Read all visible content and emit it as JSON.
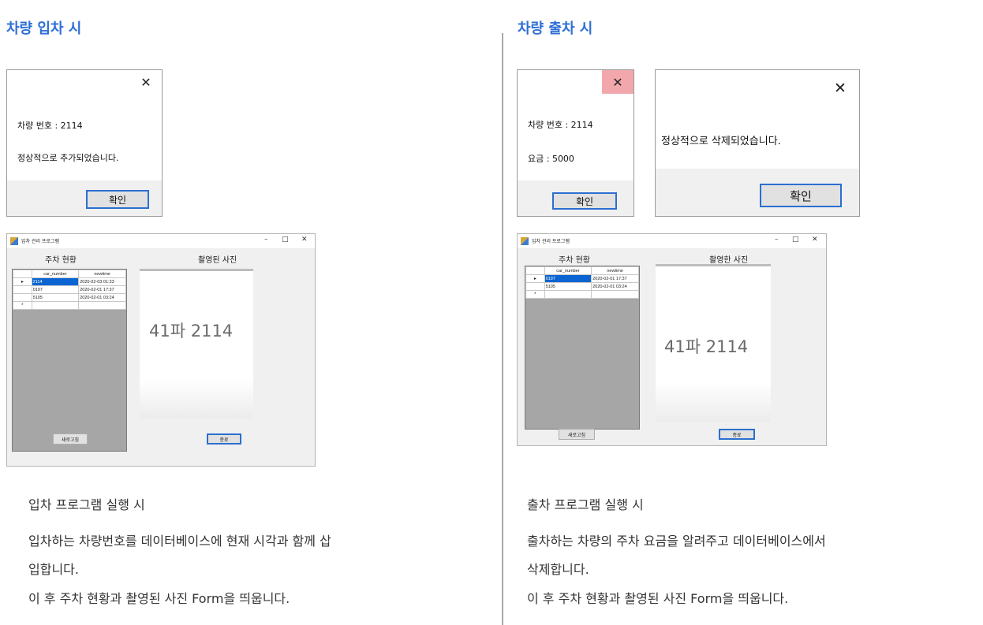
{
  "left": {
    "heading": "차량 입차 시",
    "msgbox": {
      "close": "✕",
      "line1": "차량 번호 :  2114",
      "line2": "정상적으로 추가되었습니다.",
      "ok": "확인"
    },
    "window": {
      "title": "입차 관리 프로그램",
      "controls": [
        "–",
        "□",
        "✕"
      ],
      "label_status": "주차 현황",
      "label_photo": "촬영된 사진",
      "grid": {
        "headers": [
          "car_number",
          "newtime"
        ],
        "rows": [
          {
            "indicator": "▸",
            "car_number": "2114",
            "newtime": "2020-02-03 01:33"
          },
          {
            "indicator": "",
            "car_number": "0197",
            "newtime": "2020-02-01 17:37"
          },
          {
            "indicator": "",
            "car_number": "5105",
            "newtime": "2020-02-01 03:24"
          },
          {
            "indicator": "*",
            "car_number": "",
            "newtime": ""
          }
        ]
      },
      "plate": "41파  2114",
      "refresh": "새로고침",
      "exit": "종료"
    },
    "desc": [
      "입차 프로그램 실행 시",
      "입차하는 차량번호를 데이터베이스에 현재 시각과 함께 삽",
      "입합니다.",
      "이 후 주차 현황과 촬영된 사진 Form을 띄웁니다."
    ]
  },
  "right": {
    "heading": "차량 출차 시",
    "msgbox1": {
      "close": "✕",
      "line1": "차량 번호 :  2114",
      "line2": "요금 : 5000",
      "ok": "확인"
    },
    "msgbox2": {
      "close": "✕",
      "line1": "정상적으로 삭제되었습니다.",
      "ok": "확인"
    },
    "window": {
      "title": "입차 관리 프로그램",
      "controls": [
        "–",
        "□",
        "✕"
      ],
      "label_status": "주차 현황",
      "label_photo": "촬영한 사진",
      "grid": {
        "headers": [
          "car_number",
          "newtime"
        ],
        "rows": [
          {
            "indicator": "▸",
            "car_number": "0197",
            "newtime": "2020-02-01 17:37"
          },
          {
            "indicator": "",
            "car_number": "5105",
            "newtime": "2020-02-01 03:24"
          },
          {
            "indicator": "*",
            "car_number": "",
            "newtime": ""
          }
        ]
      },
      "plate": "41파  2114",
      "refresh": "새로고침",
      "exit": "종료"
    },
    "desc": [
      "출차 프로그램 실행 시",
      "출차하는 차량의 주차 요금을 알려주고 데이터베이스에서",
      "삭제합니다.",
      "이 후 주차 현황과 촬영된 사진 Form을 띄웁니다."
    ]
  },
  "colors": {
    "heading": "#2e6fd6",
    "divider": "#a8a8a8",
    "selected_row": "#0a64d2",
    "close_hover": "#f1a7ac",
    "button_focus": "#2b6fd0"
  }
}
